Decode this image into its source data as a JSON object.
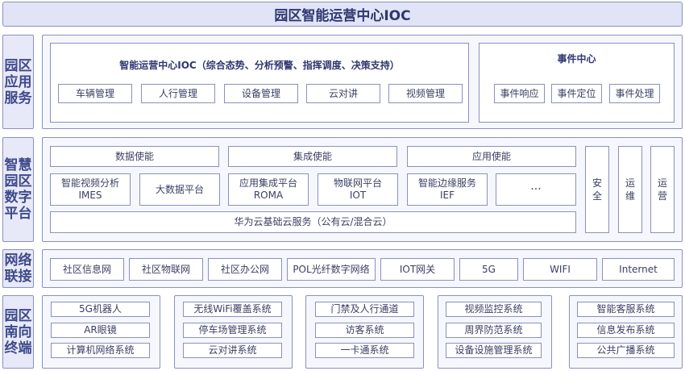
{
  "title": "园区智能运营中心IOC",
  "rows": {
    "app": {
      "label": "园区应用服务",
      "ioc": {
        "title": "智能运营中心IOC（综合态势、分析预警、指挥调度、决策支持）",
        "items": [
          "车辆管理",
          "人行管理",
          "设备管理",
          "云对讲",
          "视频管理"
        ]
      },
      "event": {
        "title": "事件中心",
        "items": [
          "事件响应",
          "事件定位",
          "事件处理"
        ]
      }
    },
    "platform": {
      "label": "智慧园区数字平台",
      "enable": [
        "数据使能",
        "集成使能",
        "应用使能"
      ],
      "services": [
        "智能视频分析\nIMES",
        "大数据平台",
        "应用集成平台\nROMA",
        "物联网平台\nIOT",
        "智能边缘服务\nIEF",
        "···"
      ],
      "cloud": "华为云基础云服务（公有云/混合云）",
      "side": [
        "安全",
        "运维",
        "运营"
      ]
    },
    "network": {
      "label": "网络联接",
      "items": [
        "社区信息网",
        "社区物联网",
        "社区办公网",
        "POL光纤数字网络",
        "IOT网关",
        "5G",
        "WIFI",
        "Internet"
      ]
    },
    "terminal": {
      "label": "园区南向终端",
      "groups": [
        [
          "5G机器人",
          "AR眼镜",
          "计算机网络系统"
        ],
        [
          "无线WiFi覆盖系统",
          "停车场管理系统",
          "云对讲系统"
        ],
        [
          "门禁及人行通道",
          "访客系统",
          "一卡通系统"
        ],
        [
          "视频监控系统",
          "周界防范系统",
          "设备设施管理系统"
        ],
        [
          "智能客服系统",
          "信息发布系统",
          "公共广播系统"
        ]
      ]
    }
  }
}
